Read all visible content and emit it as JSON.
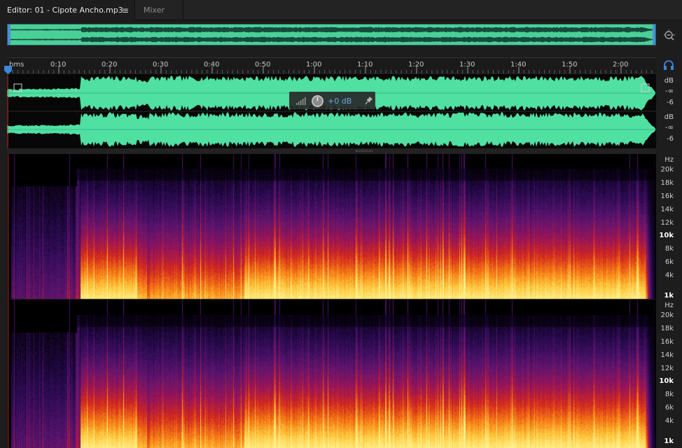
{
  "tabs": {
    "editor_label": "Editor: 01 - Cipote Ancho.mp3",
    "editor_menu_glyph": "≡",
    "mixer_label": "Mixer"
  },
  "ruler": {
    "unit_label": "hms",
    "ticks": [
      "0:10",
      "0:20",
      "0:30",
      "0:40",
      "0:50",
      "1:00",
      "1:10",
      "1:20",
      "1:30",
      "1:40",
      "1:50",
      "2:00"
    ]
  },
  "amplitude_scale": {
    "unit": "dB",
    "labels": [
      "-∞",
      "-6"
    ]
  },
  "frequency_scale": {
    "unit": "Hz",
    "labels": [
      "20k",
      "18k",
      "16k",
      "14k",
      "12k",
      "10k",
      "8k",
      "6k",
      "4k",
      "1k"
    ]
  },
  "hud": {
    "gain_text": "+0 dB"
  },
  "icons": {
    "zoom": "zoom-out-icon",
    "headphones": "headphones-icon",
    "pin": "pin-icon",
    "knob": "volume-knob-icon",
    "meter": "level-meter-icon",
    "playhead": "playhead-marker-icon"
  },
  "colors": {
    "waveform": "#4fe0a2",
    "overview_bg": "#0d2324",
    "selection_blue": "#4a8fd6",
    "background": "#1d1d1d",
    "hud_gain": "#6aa7e6"
  }
}
